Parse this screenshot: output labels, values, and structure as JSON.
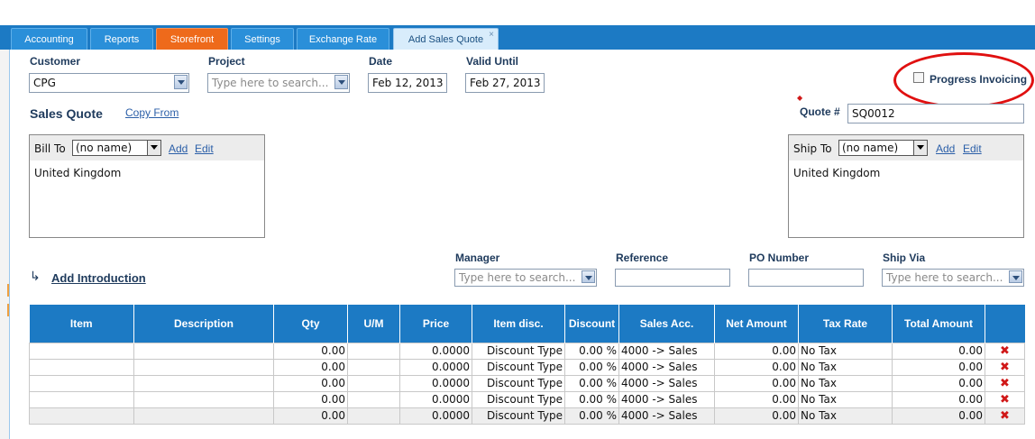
{
  "tabs": [
    {
      "label": "Accounting"
    },
    {
      "label": "Reports"
    },
    {
      "label": "Storefront"
    },
    {
      "label": "Settings"
    },
    {
      "label": "Exchange Rate"
    },
    {
      "label": "Add Sales Quote",
      "close": "×"
    }
  ],
  "header": {
    "customer_label": "Customer",
    "customer_value": "CPG",
    "project_label": "Project",
    "project_placeholder": "Type here to search...",
    "date_label": "Date",
    "date_value": "Feb 12, 2013",
    "valid_until_label": "Valid Until",
    "valid_until_value": "Feb 27, 2013",
    "progress_invoicing_label": "Progress Invoicing",
    "progress_invoicing_checked": false
  },
  "quote": {
    "title": "Sales Quote",
    "copy_from": "Copy From",
    "required_mark": "◆",
    "number_label": "Quote #",
    "number_value": "SQ0012"
  },
  "bill_to": {
    "label": "Bill To",
    "select_value": "(no name)",
    "add": "Add",
    "edit": "Edit",
    "address": "United Kingdom"
  },
  "ship_to": {
    "label": "Ship To",
    "select_value": "(no name)",
    "add": "Add",
    "edit": "Edit",
    "address": "United Kingdom"
  },
  "extra": {
    "add_intro_arrow": "↳",
    "add_introduction": "Add Introduction",
    "manager_label": "Manager",
    "manager_placeholder": "Type here to search...",
    "reference_label": "Reference",
    "reference_value": "",
    "po_label": "PO Number",
    "po_value": "",
    "ship_via_label": "Ship Via",
    "ship_via_placeholder": "Type here to search..."
  },
  "table": {
    "columns": [
      "Item",
      "Description",
      "Qty",
      "U/M",
      "Price",
      "Item disc.",
      "Discount",
      "Sales Acc.",
      "Net Amount",
      "Tax Rate",
      "Total Amount",
      ""
    ],
    "rows": [
      {
        "item": "",
        "description": "",
        "qty": "0.00",
        "um": "",
        "price": "0.0000",
        "item_disc": "Discount Type",
        "discount": "0.00 %",
        "sales_acc": "4000 -> Sales",
        "net": "0.00",
        "tax": "No Tax",
        "total": "0.00",
        "del": "✖"
      },
      {
        "item": "",
        "description": "",
        "qty": "0.00",
        "um": "",
        "price": "0.0000",
        "item_disc": "Discount Type",
        "discount": "0.00 %",
        "sales_acc": "4000 -> Sales",
        "net": "0.00",
        "tax": "No Tax",
        "total": "0.00",
        "del": "✖"
      },
      {
        "item": "",
        "description": "",
        "qty": "0.00",
        "um": "",
        "price": "0.0000",
        "item_disc": "Discount Type",
        "discount": "0.00 %",
        "sales_acc": "4000 -> Sales",
        "net": "0.00",
        "tax": "No Tax",
        "total": "0.00",
        "del": "✖"
      },
      {
        "item": "",
        "description": "",
        "qty": "0.00",
        "um": "",
        "price": "0.0000",
        "item_disc": "Discount Type",
        "discount": "0.00 %",
        "sales_acc": "4000 -> Sales",
        "net": "0.00",
        "tax": "No Tax",
        "total": "0.00",
        "del": "✖"
      },
      {
        "item": "",
        "description": "",
        "qty": "0.00",
        "um": "",
        "price": "0.0000",
        "item_disc": "Discount Type",
        "discount": "0.00 %",
        "sales_acc": "4000 -> Sales",
        "net": "0.00",
        "tax": "No Tax",
        "total": "0.00",
        "del": "✖"
      }
    ]
  },
  "colors": {
    "tab_bar": "#1c7ac4",
    "tab_orange": "#ee6a1b",
    "tab_active": "#d8ecfb",
    "header_text": "#1e3a5c",
    "link": "#2b5fa8",
    "highlight_ellipse": "#e01010",
    "delete_icon": "#d01818"
  }
}
